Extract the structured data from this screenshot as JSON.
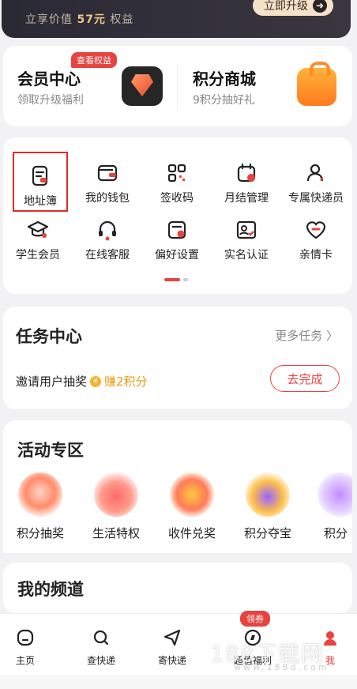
{
  "banner": {
    "subtitle_prefix": "立享价值",
    "subtitle_value": "57元",
    "subtitle_suffix": "权益",
    "upgrade_label": "立即升级"
  },
  "member": {
    "left_badge": "查看权益",
    "left_title": "会员中心",
    "left_desc": "领取升级福利",
    "right_title": "积分商城",
    "right_desc": "9积分抽好礼"
  },
  "services": [
    {
      "label": "地址簿",
      "icon": "address-book-icon"
    },
    {
      "label": "我的钱包",
      "icon": "wallet-icon"
    },
    {
      "label": "签收码",
      "icon": "qr-code-icon"
    },
    {
      "label": "月结管理",
      "icon": "calendar-icon"
    },
    {
      "label": "专属快递员",
      "icon": "courier-icon"
    },
    {
      "label": "学生会员",
      "icon": "graduation-cap-icon"
    },
    {
      "label": "在线客服",
      "icon": "headset-icon"
    },
    {
      "label": "偏好设置",
      "icon": "preference-icon"
    },
    {
      "label": "实名认证",
      "icon": "id-card-icon"
    },
    {
      "label": "亲情卡",
      "icon": "heart-link-icon"
    }
  ],
  "task": {
    "title": "任务中心",
    "more": "更多任务",
    "item_label": "邀请用户抽奖",
    "coin_glyph": "¥",
    "reward": "赚2积分",
    "button": "去完成"
  },
  "activity": {
    "title": "活动专区",
    "items": [
      "积分抽奖",
      "生活特权",
      "收件兑奖",
      "积分夺宝",
      "积分"
    ]
  },
  "channel": {
    "title": "我的频道"
  },
  "tabs": {
    "coupon": "领券",
    "items": [
      "主页",
      "查快递",
      "寄快递",
      "超值福利",
      "我"
    ]
  },
  "watermark": {
    "main": "188下载网",
    "sub": "www.188d.com"
  },
  "colors": {
    "accent": "#e8433f",
    "gold": "#e89a12"
  }
}
